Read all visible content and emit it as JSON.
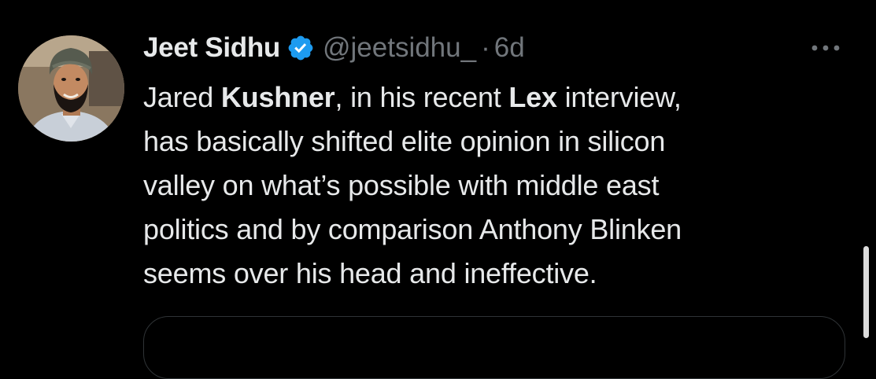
{
  "tweet": {
    "author": {
      "display_name": "Jeet Sidhu",
      "handle": "@jeetsidhu_",
      "verified_icon": "verified-badge-icon"
    },
    "separator": "·",
    "timestamp": "6d",
    "more_icon": "more-horizontal-icon",
    "text": {
      "l1_a": "Jared ",
      "l1_b": "Kushner",
      "l1_c": ", in his recent ",
      "l1_d": "Lex",
      "l1_e": " interview,",
      "l2": "has basically shifted elite opinion in silicon",
      "l3": "valley on what’s possible with middle east",
      "l4": "politics and by comparison Anthony Blinken",
      "l5": "seems over his head and ineffective."
    }
  },
  "colors": {
    "background": "#000000",
    "primary_text": "#e7e9ea",
    "secondary_text": "#71767b",
    "verified_blue": "#1d9bf0",
    "border": "#2f3336"
  }
}
